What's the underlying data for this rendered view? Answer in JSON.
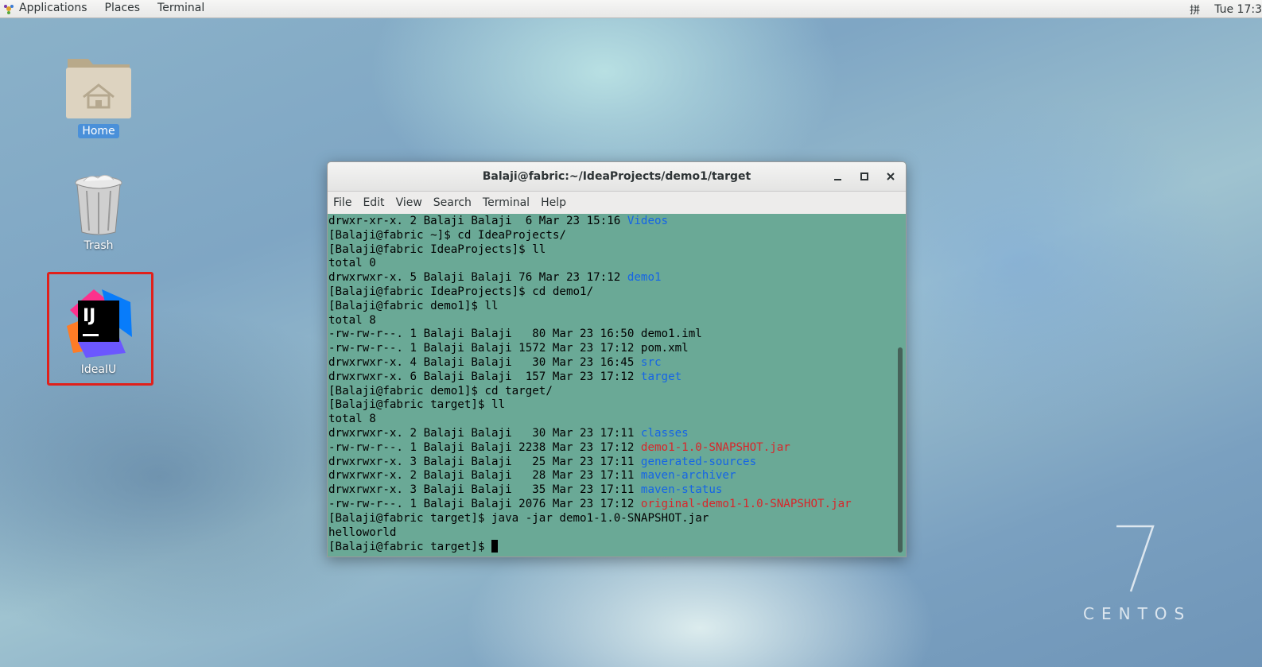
{
  "topbar": {
    "menus": [
      "Applications",
      "Places",
      "Terminal"
    ],
    "ime": "拼",
    "clock": "Tue 17:3"
  },
  "desktop": {
    "icons": [
      {
        "label": "Home"
      },
      {
        "label": "Trash"
      },
      {
        "label": "IdeaIU"
      }
    ]
  },
  "terminal": {
    "title": "Balaji@fabric:~/IdeaProjects/demo1/target",
    "menus": [
      "File",
      "Edit",
      "View",
      "Search",
      "Terminal",
      "Help"
    ],
    "lines": [
      [
        {
          "t": "drwxr-xr-x. 2 Balaji Balaji  6 Mar 23 15:16 "
        },
        {
          "t": "Videos",
          "c": "dir"
        }
      ],
      [
        {
          "t": "[Balaji@fabric ~]$ cd IdeaProjects/"
        }
      ],
      [
        {
          "t": "[Balaji@fabric IdeaProjects]$ ll"
        }
      ],
      [
        {
          "t": "total 0"
        }
      ],
      [
        {
          "t": "drwxrwxr-x. 5 Balaji Balaji 76 Mar 23 17:12 "
        },
        {
          "t": "demo1",
          "c": "dir"
        }
      ],
      [
        {
          "t": "[Balaji@fabric IdeaProjects]$ cd demo1/"
        }
      ],
      [
        {
          "t": "[Balaji@fabric demo1]$ ll"
        }
      ],
      [
        {
          "t": "total 8"
        }
      ],
      [
        {
          "t": "-rw-rw-r--. 1 Balaji Balaji   80 Mar 23 16:50 demo1.iml"
        }
      ],
      [
        {
          "t": "-rw-rw-r--. 1 Balaji Balaji 1572 Mar 23 17:12 pom.xml"
        }
      ],
      [
        {
          "t": "drwxrwxr-x. 4 Balaji Balaji   30 Mar 23 16:45 "
        },
        {
          "t": "src",
          "c": "dir"
        }
      ],
      [
        {
          "t": "drwxrwxr-x. 6 Balaji Balaji  157 Mar 23 17:12 "
        },
        {
          "t": "target",
          "c": "dir"
        }
      ],
      [
        {
          "t": "[Balaji@fabric demo1]$ cd target/"
        }
      ],
      [
        {
          "t": "[Balaji@fabric target]$ ll"
        }
      ],
      [
        {
          "t": "total 8"
        }
      ],
      [
        {
          "t": "drwxrwxr-x. 2 Balaji Balaji   30 Mar 23 17:11 "
        },
        {
          "t": "classes",
          "c": "dir"
        }
      ],
      [
        {
          "t": "-rw-rw-r--. 1 Balaji Balaji 2238 Mar 23 17:12 "
        },
        {
          "t": "demo1-1.0-SNAPSHOT.jar",
          "c": "jar"
        }
      ],
      [
        {
          "t": "drwxrwxr-x. 3 Balaji Balaji   25 Mar 23 17:11 "
        },
        {
          "t": "generated-sources",
          "c": "dir"
        }
      ],
      [
        {
          "t": "drwxrwxr-x. 2 Balaji Balaji   28 Mar 23 17:11 "
        },
        {
          "t": "maven-archiver",
          "c": "dir"
        }
      ],
      [
        {
          "t": "drwxrwxr-x. 3 Balaji Balaji   35 Mar 23 17:11 "
        },
        {
          "t": "maven-status",
          "c": "dir"
        }
      ],
      [
        {
          "t": "-rw-rw-r--. 1 Balaji Balaji 2076 Mar 23 17:12 "
        },
        {
          "t": "original-demo1-1.0-SNAPSHOT.jar",
          "c": "jar"
        }
      ],
      [
        {
          "t": "[Balaji@fabric target]$ java -jar demo1-1.0-SNAPSHOT.jar"
        }
      ],
      [
        {
          "t": "helloworld"
        }
      ],
      [
        {
          "t": "[Balaji@fabric target]$ "
        },
        {
          "cursor": true
        }
      ]
    ]
  },
  "watermark": {
    "text": "CENTOS"
  },
  "colors": {
    "terminal_bg": "#6aa996",
    "dir": "#1565e6",
    "jar": "#d8262a",
    "highlight": "#e0201b",
    "selection": "#4a90d9"
  }
}
